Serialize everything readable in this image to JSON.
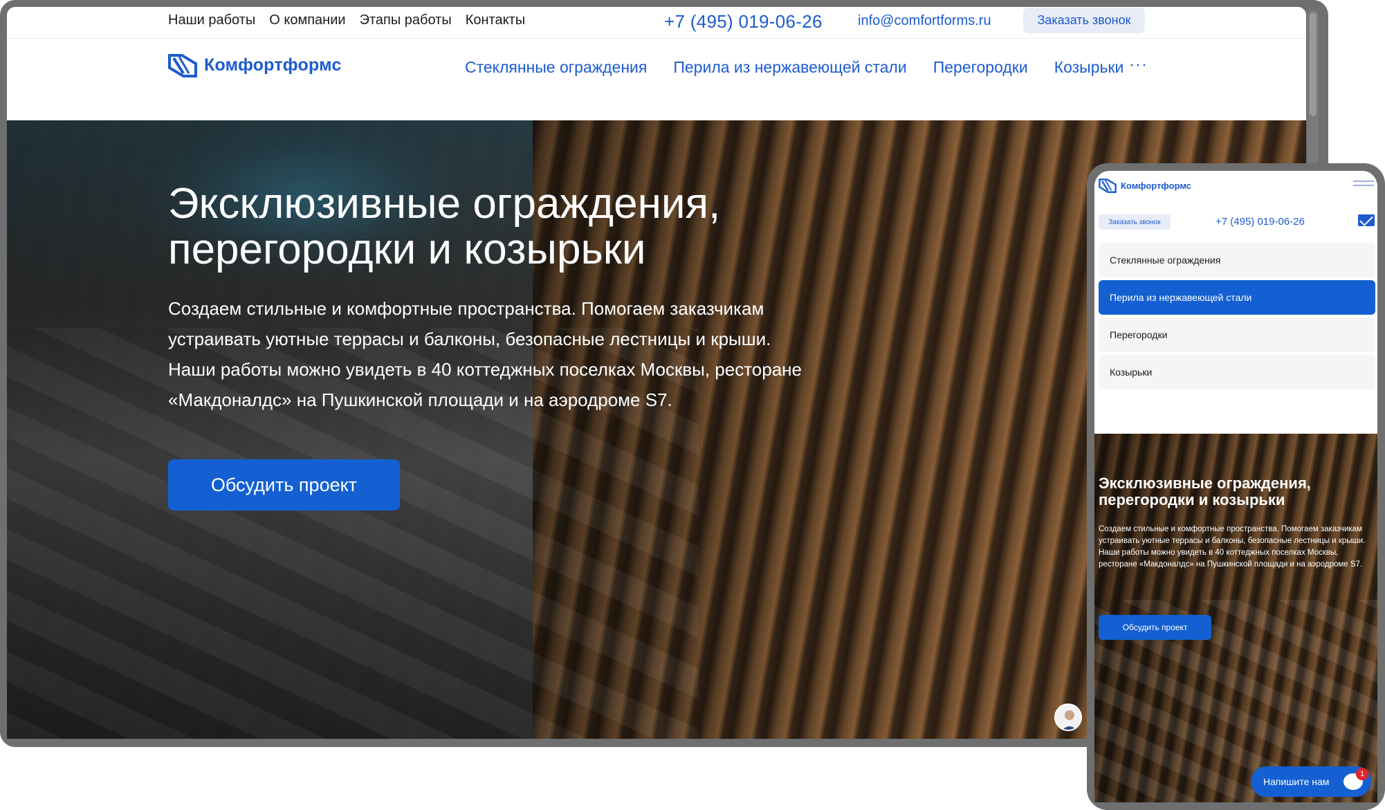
{
  "desktop": {
    "topnav": [
      "Наши работы",
      "О компании",
      "Этапы работы",
      "Контакты"
    ],
    "phone": "+7 (495) 019-06-26",
    "email": "info@comfortforms.ru",
    "callback_label": "Заказать звонок",
    "logo_text": "Комфортформс",
    "mainmenu": [
      "Стеклянные ограждения",
      "Перила из нержавеющей стали",
      "Перегородки",
      "Козырьки"
    ],
    "more_label": "···",
    "hero": {
      "title_line1": "Эксклюзивные ограждения,",
      "title_line2": "перегородки и козырьки",
      "text": "Создаем стильные и комфортные пространства. Помогаем заказчикам устраивать уютные террасы и балконы, безопасные лестницы и крыши. Наши работы можно увидеть в 40 коттеджных поселках Москвы, ресторане «Макдоналдс» на Пушкинской площади и на аэродроме S7.",
      "cta_label": "Обсудить проект"
    }
  },
  "mobile": {
    "logo_text": "Комфортформс",
    "callback_label": "Заказать звонок",
    "phone": "+7 (495) 019-06-26",
    "menu": [
      "Стеклянные ограждения",
      "Перила из нержавеющей стали",
      "Перегородки",
      "Козырьки"
    ],
    "active_menu_item": "Перила из нержавеющей стали",
    "hero": {
      "title_line1": "Эксклюзивные ограждения,",
      "title_line2": "перегородки и козырьки",
      "text": "Создаем стильные и комфортные пространства. Помогаем заказчикам устраивать уютные террасы и балконы, безопасные лестницы и крыши. Наши работы можно увидеть в 40 коттеджных поселках Москвы, ресторане «Макдоналдс» на Пушкинской площади и на аэродроме S7.",
      "cta_label": "Обсудить проект"
    },
    "chat_label": "Напишите нам",
    "chat_badge": "1"
  },
  "colors": {
    "brand_blue": "#1d5bd1",
    "cta_blue": "#1460d2",
    "badge_red": "#e0242a"
  },
  "icons": {
    "logo": "comfortforms-logo-icon",
    "burger": "hamburger-menu-icon",
    "mail": "envelope-icon",
    "chat": "chat-bubble-icon"
  }
}
